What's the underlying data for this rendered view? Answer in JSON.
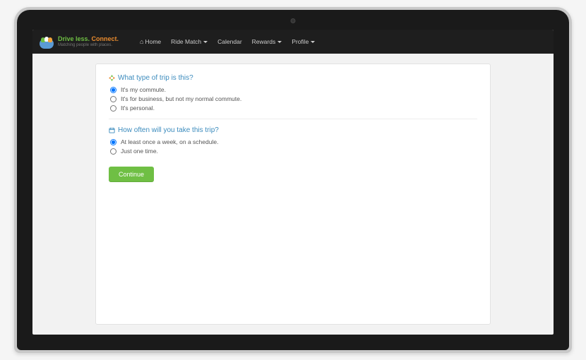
{
  "brand": {
    "word1": "Drive less.",
    "word2": " Connect.",
    "tagline": "Matching people with places."
  },
  "nav": {
    "home": "Home",
    "ridematch": "Ride Match",
    "calendar": "Calendar",
    "rewards": "Rewards",
    "profile": "Profile"
  },
  "form": {
    "q1": {
      "label": "What type of trip is this?",
      "opt1": "It's my commute.",
      "opt2": "It's for business, but not my normal commute.",
      "opt3": "It's personal."
    },
    "q2": {
      "label": "How often will you take this trip?",
      "opt1": "At least once a week, on a schedule.",
      "opt2": "Just one time."
    },
    "continue": "Continue"
  }
}
